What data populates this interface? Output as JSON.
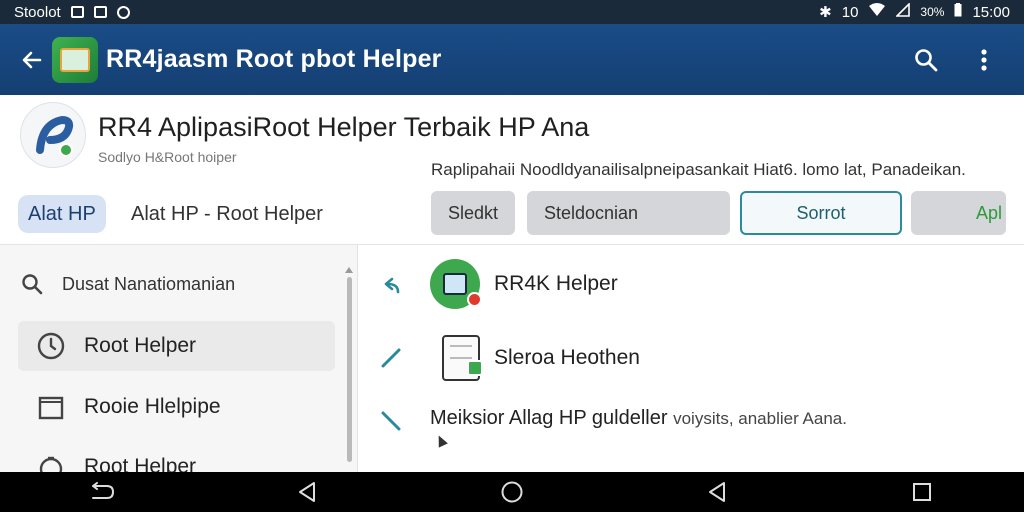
{
  "status_bar": {
    "left_text": "Stoolot",
    "right_num": "10",
    "right_pct": "30%",
    "time": "15:00",
    "icons": [
      "image-icon",
      "box-icon",
      "record-icon",
      "bluetooth-icon",
      "wifi-icon",
      "signal-icon",
      "battery-icon"
    ]
  },
  "app_bar": {
    "title": "RR4jaasm Root pbot Helper",
    "icons": [
      "back-arrow-icon",
      "app-logo-icon",
      "search-icon",
      "more-vert-icon"
    ]
  },
  "header": {
    "title": "RR4  AplipasiRoot Helper Terbaik HP Ana",
    "subtitle": "Sodlyo H&Root hoiper",
    "description": "Raplipahaii Noodldyanailisalpneipasankait Hiat6. lomo lat, Panadeikan."
  },
  "chips": {
    "main_chip": "Alat HP",
    "chip_label": "Alat HP - Root Helper"
  },
  "actions": {
    "btn_a": "Sledkt",
    "btn_b": "Steldocnian",
    "btn_c": "Sorrot",
    "btn_d": "Apl"
  },
  "sidebar": {
    "search_label": "Dusat Nanatiomanian",
    "items": [
      {
        "label": "Root Helper",
        "icon": "clock-icon",
        "active": true
      },
      {
        "label": "Rooie Hlelpipe",
        "icon": "square-icon",
        "active": false
      },
      {
        "label": "Root Helper",
        "icon": "circle-icon",
        "active": false
      }
    ]
  },
  "content": {
    "rows": [
      {
        "label": "RR4K Helper",
        "icon": "app-round-icon"
      },
      {
        "label": "Sleroa Heothen",
        "icon": "document-lock-icon"
      }
    ],
    "text_main": "Meiksior Allag HP  guldeller",
    "text_muted": "voiysits, anablier Aana."
  },
  "colors": {
    "status_bar": "#1b2a3a",
    "app_bar": "#1a4c86",
    "accent": "#2d8a9c",
    "chip_bg": "#d7e3f5",
    "green": "#3ea84e"
  }
}
